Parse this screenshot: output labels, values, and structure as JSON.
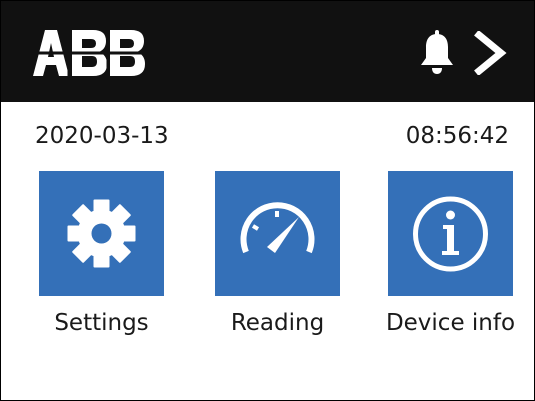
{
  "header": {
    "logo_text": "ABB",
    "background_color": "#111111",
    "icons": [
      "bell-icon",
      "chevron-right-icon"
    ]
  },
  "status": {
    "date": "2020-03-13",
    "time": "08:56:42"
  },
  "tiles": [
    {
      "label": "Settings",
      "icon": "gear-icon"
    },
    {
      "label": "Reading",
      "icon": "gauge-icon"
    },
    {
      "label": "Device info",
      "icon": "info-icon"
    }
  ],
  "colors": {
    "tile_blue": "#3470b8",
    "icon_white": "#ffffff",
    "text": "#1a1a1a"
  }
}
